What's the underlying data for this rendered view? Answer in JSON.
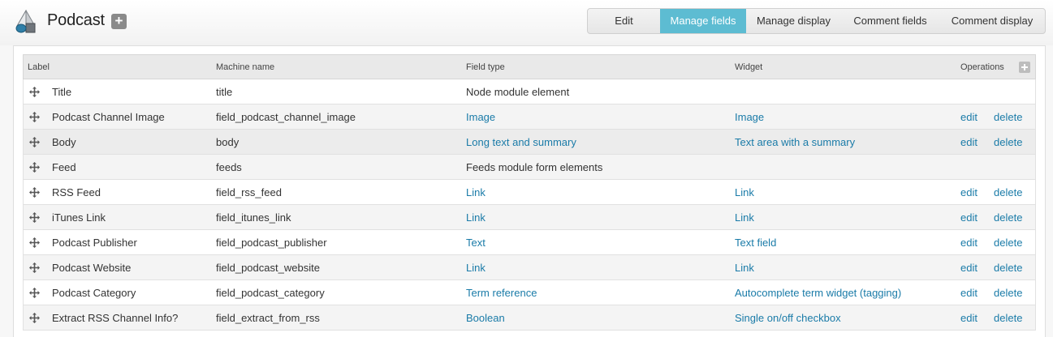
{
  "header": {
    "title": "Podcast",
    "add_label": "+",
    "tabs": [
      {
        "label": "Edit",
        "active": false
      },
      {
        "label": "Manage fields",
        "active": true
      },
      {
        "label": "Manage display",
        "active": false
      },
      {
        "label": "Comment fields",
        "active": false
      },
      {
        "label": "Comment display",
        "active": false
      }
    ],
    "active_tab_color": "#5dbcd2"
  },
  "table": {
    "columns": {
      "label": "Label",
      "machine_name": "Machine name",
      "field_type": "Field type",
      "widget": "Widget",
      "operations": "Operations"
    },
    "rows": [
      {
        "label": "Title",
        "machine_name": "title",
        "field_type": "Node module element",
        "widget": "",
        "edit": "",
        "delete": ""
      },
      {
        "label": "Podcast Channel Image",
        "machine_name": "field_podcast_channel_image",
        "field_type": "Image",
        "widget": "Image",
        "edit": "edit",
        "delete": "delete"
      },
      {
        "label": "Body",
        "machine_name": "body",
        "field_type": "Long text and summary",
        "widget": "Text area with a summary",
        "edit": "edit",
        "delete": "delete"
      },
      {
        "label": "Feed",
        "machine_name": "feeds",
        "field_type": "Feeds module form elements",
        "widget": "",
        "edit": "",
        "delete": ""
      },
      {
        "label": "RSS Feed",
        "machine_name": "field_rss_feed",
        "field_type": "Link",
        "widget": "Link",
        "edit": "edit",
        "delete": "delete"
      },
      {
        "label": "iTunes Link",
        "machine_name": "field_itunes_link",
        "field_type": "Link",
        "widget": "Link",
        "edit": "edit",
        "delete": "delete"
      },
      {
        "label": "Podcast Publisher",
        "machine_name": "field_podcast_publisher",
        "field_type": "Text",
        "widget": "Text field",
        "edit": "edit",
        "delete": "delete"
      },
      {
        "label": "Podcast Website",
        "machine_name": "field_podcast_website",
        "field_type": "Link",
        "widget": "Link",
        "edit": "edit",
        "delete": "delete"
      },
      {
        "label": "Podcast Category",
        "machine_name": "field_podcast_category",
        "field_type": "Term reference",
        "widget": "Autocomplete term widget (tagging)",
        "edit": "edit",
        "delete": "delete"
      },
      {
        "label": "Extract RSS Channel Info?",
        "machine_name": "field_extract_from_rss",
        "field_type": "Boolean",
        "widget": "Single on/off checkbox",
        "edit": "edit",
        "delete": "delete"
      }
    ]
  },
  "link_color": "#1a7ba8"
}
